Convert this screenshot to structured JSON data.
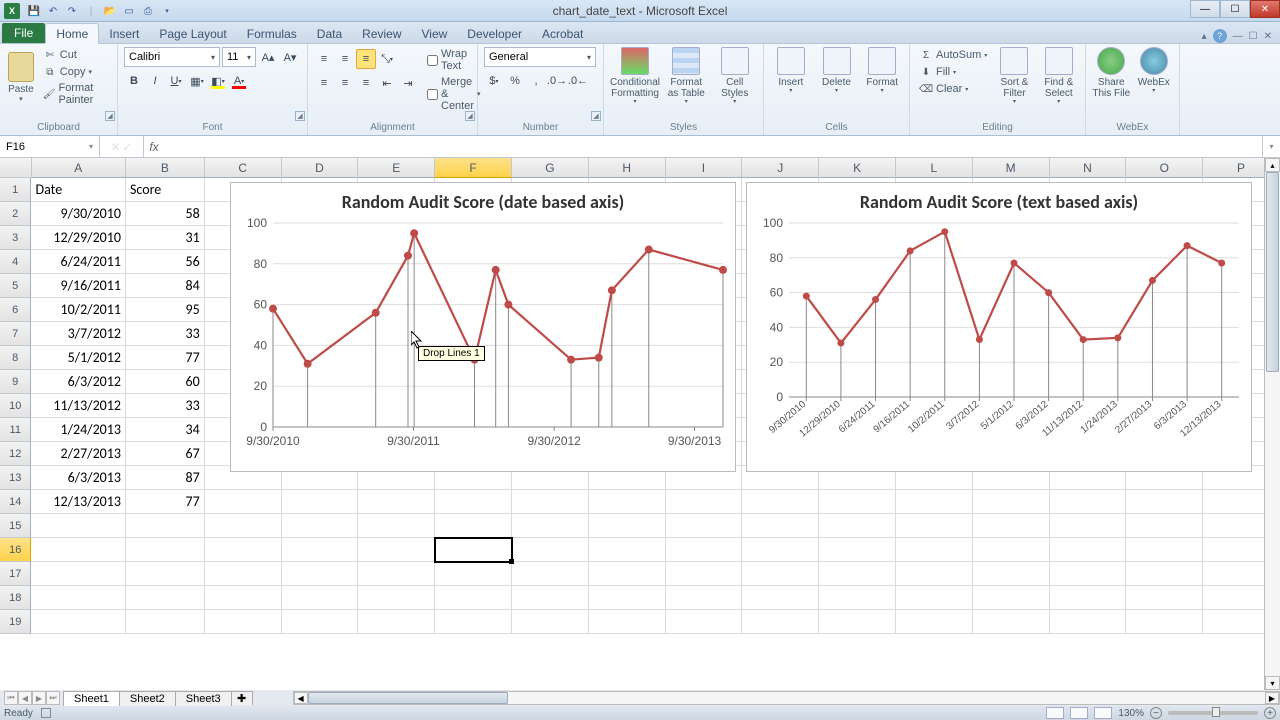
{
  "app": {
    "title": "chart_date_text - Microsoft Excel"
  },
  "qat": {
    "items": [
      "save",
      "undo",
      "redo",
      "open",
      "new",
      "print",
      "preview"
    ]
  },
  "tabs": [
    "File",
    "Home",
    "Insert",
    "Page Layout",
    "Formulas",
    "Data",
    "Review",
    "View",
    "Developer",
    "Acrobat"
  ],
  "active_tab": "Home",
  "ribbon": {
    "clipboard": {
      "label": "Clipboard",
      "paste": "Paste",
      "cut": "Cut",
      "copy": "Copy",
      "fp": "Format Painter"
    },
    "font": {
      "label": "Font",
      "name": "Calibri",
      "size": "11"
    },
    "alignment": {
      "label": "Alignment",
      "wrap": "Wrap Text",
      "merge": "Merge & Center"
    },
    "number": {
      "label": "Number",
      "format": "General"
    },
    "styles": {
      "label": "Styles",
      "cf": "Conditional Formatting",
      "fat": "Format as Table",
      "cs": "Cell Styles"
    },
    "cells": {
      "label": "Cells",
      "insert": "Insert",
      "delete": "Delete",
      "format": "Format"
    },
    "editing": {
      "label": "Editing",
      "autosum": "AutoSum",
      "fill": "Fill",
      "clear": "Clear",
      "sort": "Sort & Filter",
      "find": "Find & Select"
    },
    "webex": {
      "label": "WebEx",
      "share": "Share This File",
      "wx": "WebEx"
    }
  },
  "namebox": "F16",
  "columns": [
    "A",
    "B",
    "C",
    "D",
    "E",
    "F",
    "G",
    "H",
    "I",
    "J",
    "K",
    "L",
    "M",
    "N",
    "O",
    "P"
  ],
  "selected_col": "F",
  "selected_row": 16,
  "table": {
    "headers": {
      "A": "Date",
      "B": "Score"
    },
    "rows": [
      {
        "A": "9/30/2010",
        "B": "58"
      },
      {
        "A": "12/29/2010",
        "B": "31"
      },
      {
        "A": "6/24/2011",
        "B": "56"
      },
      {
        "A": "9/16/2011",
        "B": "84"
      },
      {
        "A": "10/2/2011",
        "B": "95"
      },
      {
        "A": "3/7/2012",
        "B": "33"
      },
      {
        "A": "5/1/2012",
        "B": "77"
      },
      {
        "A": "6/3/2012",
        "B": "60"
      },
      {
        "A": "11/13/2012",
        "B": "33"
      },
      {
        "A": "1/24/2013",
        "B": "34"
      },
      {
        "A": "2/27/2013",
        "B": "67"
      },
      {
        "A": "6/3/2013",
        "B": "87"
      },
      {
        "A": "12/13/2013",
        "B": "77"
      }
    ]
  },
  "chart_data": [
    {
      "type": "line",
      "title": "Random Audit Score (date based axis)",
      "ylim": [
        0,
        100
      ],
      "y_ticks": [
        0,
        20,
        40,
        60,
        80,
        100
      ],
      "x_ticks": [
        "9/30/2010",
        "9/30/2011",
        "9/30/2012",
        "9/30/2013"
      ],
      "x_axis_type": "date",
      "x_range_serial": [
        40451,
        41621
      ],
      "drop_lines": true,
      "series": [
        {
          "name": "Score",
          "points": [
            {
              "x": "9/30/2010",
              "serial": 40451,
              "y": 58
            },
            {
              "x": "12/29/2010",
              "serial": 40541,
              "y": 31
            },
            {
              "x": "6/24/2011",
              "serial": 40718,
              "y": 56
            },
            {
              "x": "9/16/2011",
              "serial": 40802,
              "y": 84
            },
            {
              "x": "10/2/2011",
              "serial": 40818,
              "y": 95
            },
            {
              "x": "3/7/2012",
              "serial": 40975,
              "y": 33
            },
            {
              "x": "5/1/2012",
              "serial": 41030,
              "y": 77
            },
            {
              "x": "6/3/2012",
              "serial": 41063,
              "y": 60
            },
            {
              "x": "11/13/2012",
              "serial": 41226,
              "y": 33
            },
            {
              "x": "1/24/2013",
              "serial": 41298,
              "y": 34
            },
            {
              "x": "2/27/2013",
              "serial": 41332,
              "y": 67
            },
            {
              "x": "6/3/2013",
              "serial": 41428,
              "y": 87
            },
            {
              "x": "12/13/2013",
              "serial": 41621,
              "y": 77
            }
          ]
        }
      ],
      "tooltip": "Drop Lines 1"
    },
    {
      "type": "line",
      "title": "Random Audit Score (text based axis)",
      "ylim": [
        0,
        100
      ],
      "y_ticks": [
        0,
        20,
        40,
        60,
        80,
        100
      ],
      "x_axis_type": "category",
      "drop_lines": true,
      "categories": [
        "9/30/2010",
        "12/29/2010",
        "6/24/2011",
        "9/16/2011",
        "10/2/2011",
        "3/7/2012",
        "5/1/2012",
        "6/3/2012",
        "11/13/2012",
        "1/24/2013",
        "2/27/2013",
        "6/3/2013",
        "12/13/2013"
      ],
      "series": [
        {
          "name": "Score",
          "values": [
            58,
            31,
            56,
            84,
            95,
            33,
            77,
            60,
            33,
            34,
            67,
            87,
            77
          ]
        }
      ]
    }
  ],
  "sheets": [
    "Sheet1",
    "Sheet2",
    "Sheet3"
  ],
  "active_sheet": "Sheet1",
  "status": {
    "left": "Ready",
    "zoom": "130%"
  }
}
